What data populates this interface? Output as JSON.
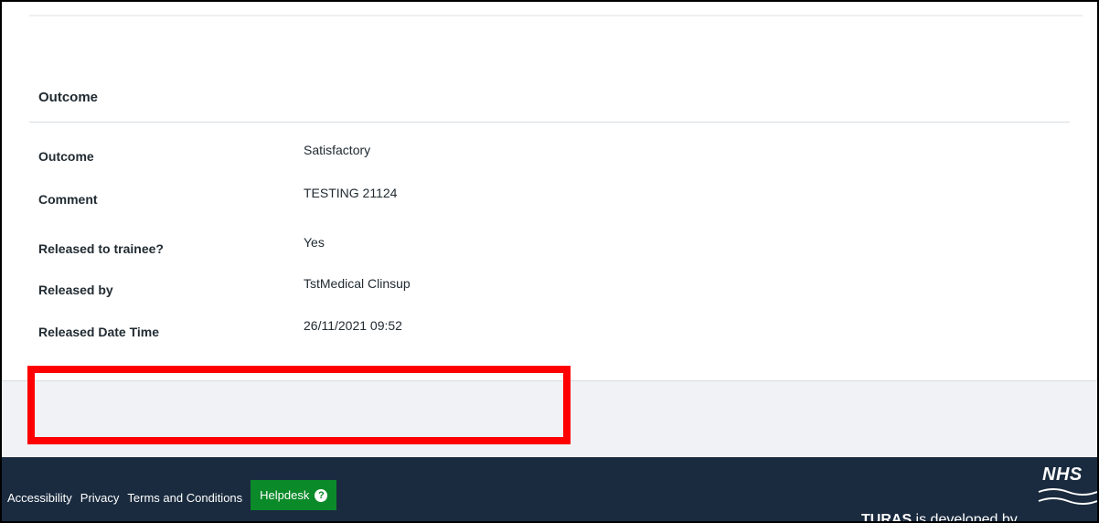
{
  "outcome_section": {
    "title": "Outcome",
    "rows": [
      {
        "label": "Outcome",
        "value": "Satisfactory"
      },
      {
        "label": "Comment",
        "value": "TESTING 21124"
      },
      {
        "label": "Released to trainee?",
        "value": "Yes"
      },
      {
        "label": "Released by",
        "value": "TstMedical Clinsup"
      },
      {
        "label": "Released Date Time",
        "value": "26/11/2021 09:52"
      }
    ]
  },
  "footer": {
    "links": [
      "Accessibility",
      "Privacy",
      "Terms and Conditions"
    ],
    "helpdesk_label": "Helpdesk",
    "help_icon": "question-circle-icon",
    "developed_brand": "TURAS",
    "developed_text": " is developed by",
    "logo_text": "NHS"
  },
  "colors": {
    "footer_bg": "#1a2b3f",
    "helpdesk_bg": "#0b8a2a",
    "highlight": "#ff0000",
    "band_bg": "#f0f2f5"
  }
}
